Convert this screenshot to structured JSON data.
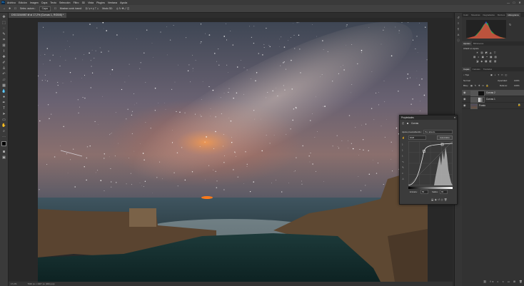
{
  "app": {
    "logo": "Ps"
  },
  "menu": {
    "items": [
      "Archivo",
      "Edición",
      "Imagen",
      "Capa",
      "Texto",
      "Selección",
      "Filtro",
      "3D",
      "Vista",
      "Plugins",
      "Ventana",
      "Ayuda"
    ],
    "min": "—",
    "max": "□",
    "close": "✕"
  },
  "options_bar": {
    "mode": "Selec. autom.:",
    "target": "Capa",
    "transform": "Mostrar contr. transf.",
    "mode3d": "Modo 3D:"
  },
  "document": {
    "tab_title": "DSC0244987.tif al 17,2% (Curvas 1, RGB/8) *",
    "zoom": "17,2%",
    "doc_info": "7040 px x 4467 px (300 ppp)"
  },
  "panels": {
    "top_tabs": [
      "Color",
      "Muestras",
      "Degradados",
      "Motivos",
      "Histograma"
    ],
    "active_top_tab": "Histograma",
    "adjust_tabs": [
      "Ajustes",
      "Bibliotecas"
    ],
    "adjust_label": "Añadir un ajuste",
    "layers_tabs": [
      "Capas",
      "Canales",
      "Trazados"
    ],
    "layers_filter": "Tipo",
    "blend_mode": "Normal",
    "opacity_label": "Opacidad:",
    "opacity": "100%",
    "lock_label": "Bloq.:",
    "fill_label": "Relleno:",
    "fill": "100%",
    "layers": [
      {
        "name": "Curvas 2"
      },
      {
        "name": "Curvas 1"
      },
      {
        "name": "Fondo"
      }
    ]
  },
  "properties": {
    "title": "Propiedades",
    "subtitle": "Curvas",
    "preset_label": "Ajuste preestablecido:",
    "preset_value": "Por defecto",
    "channel": "RGB",
    "auto_button": "Automático",
    "input_label": "Entrada:",
    "input_value": "55",
    "output_label": "Salida:",
    "output_value": "65"
  },
  "colors": {
    "accent": "#31a8ff",
    "panel": "#323232",
    "canvas": "#282828"
  }
}
